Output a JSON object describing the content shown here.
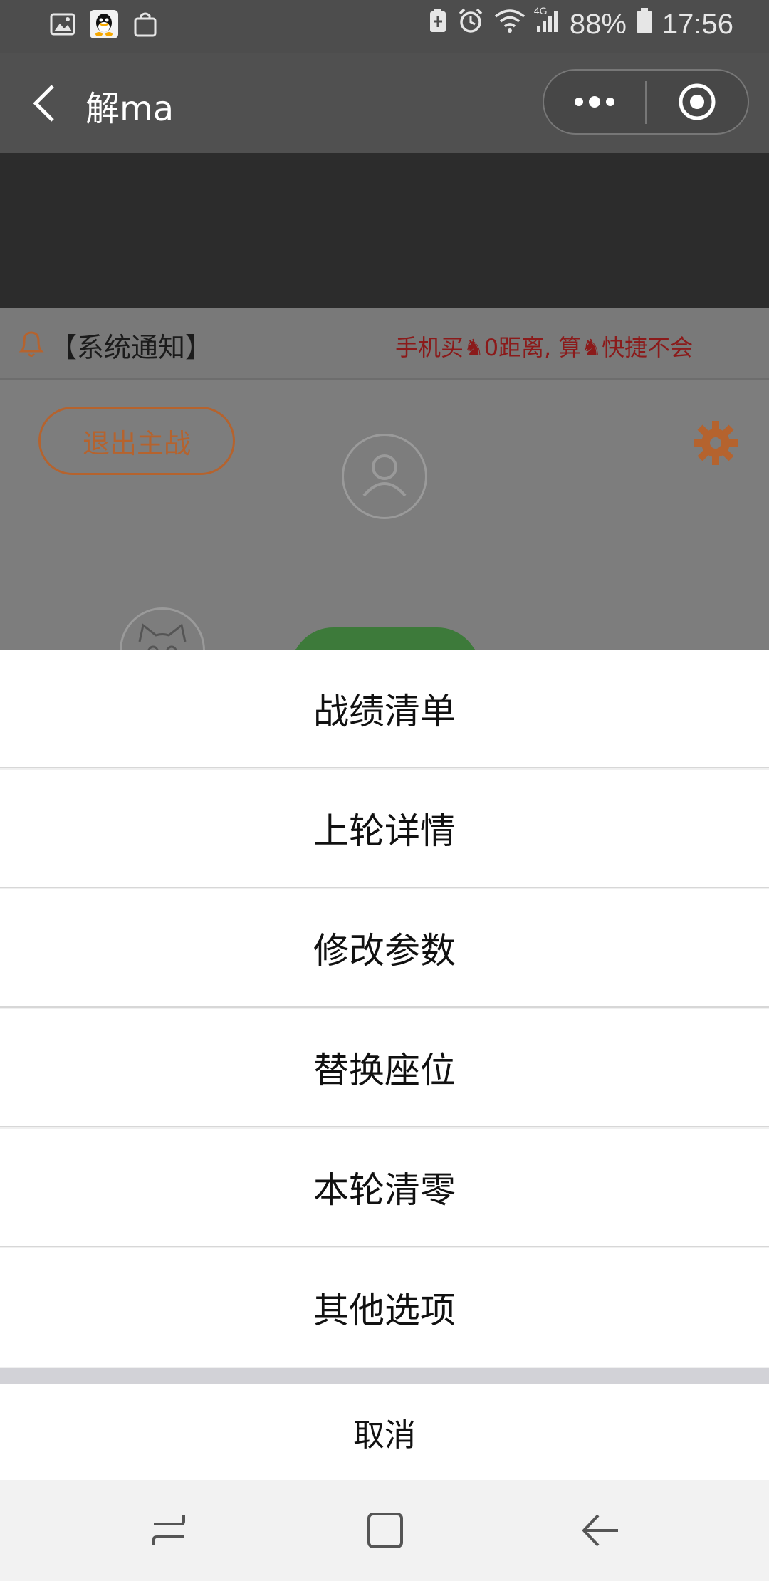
{
  "status_bar": {
    "signal_label": "4G",
    "battery": "88%",
    "time": "17:56"
  },
  "header": {
    "title": "解ma"
  },
  "notice": {
    "label": "【系统通知】",
    "scroll_text": "手机买♞0距离, 算♞快捷不会"
  },
  "main": {
    "exit_button": "退出主战"
  },
  "action_sheet": {
    "items": [
      {
        "label": "战绩清单"
      },
      {
        "label": "上轮详情"
      },
      {
        "label": "修改参数"
      },
      {
        "label": "替换座位"
      },
      {
        "label": "本轮清零"
      },
      {
        "label": "其他选项"
      }
    ],
    "cancel": "取消"
  },
  "colors": {
    "accent_orange": "#b5632e",
    "notice_red": "#8b1a1a",
    "green_button": "#3d7a3a"
  },
  "icons": [
    "image-icon",
    "qq-icon",
    "bag-icon",
    "battery-saver-icon",
    "alarm-icon",
    "wifi-icon",
    "signal-icon",
    "battery-icon",
    "back-icon",
    "more-icon",
    "close-target-icon",
    "bell-icon",
    "gear-icon",
    "avatar-icon",
    "recent-apps-icon",
    "home-icon",
    "nav-back-icon"
  ]
}
